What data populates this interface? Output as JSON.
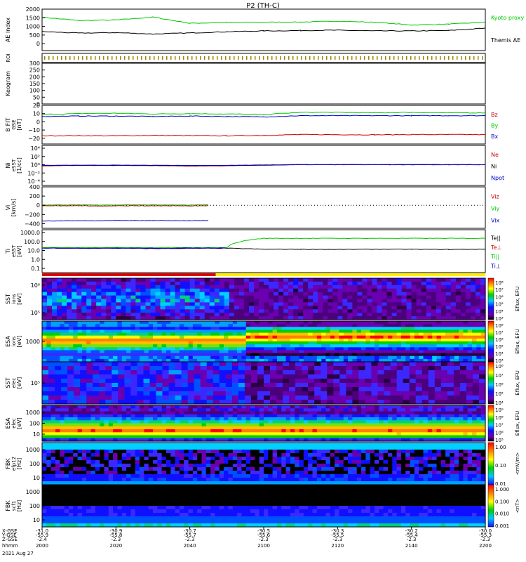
{
  "title": "P2 (TH-C)",
  "time_axis": {
    "row_labels": [
      "X-GSE",
      "Y-GSE",
      "Z-GSE",
      "hhmm",
      "2021 Aug 27"
    ],
    "columns": [
      {
        "x_gse": "-31.0",
        "y_gse": "-55.9",
        "z_gse": "-2.4",
        "hhmm": "2000"
      },
      {
        "x_gse": "-30.9",
        "y_gse": "-55.8",
        "z_gse": "-2.3",
        "hhmm": "2020"
      },
      {
        "x_gse": "-30.7",
        "y_gse": "-55.7",
        "z_gse": "-2.3",
        "hhmm": "2040"
      },
      {
        "x_gse": "-30.5",
        "y_gse": "-55.6",
        "z_gse": "-2.3",
        "hhmm": "2100"
      },
      {
        "x_gse": "-30.3",
        "y_gse": "-55.5",
        "z_gse": "-2.3",
        "hhmm": "2120"
      },
      {
        "x_gse": "-30.2",
        "y_gse": "-55.4",
        "z_gse": "-2.3",
        "hhmm": "2140"
      },
      {
        "x_gse": "-30.0",
        "y_gse": "-55.3",
        "z_gse": "-2.3",
        "hhmm": "2200"
      }
    ]
  },
  "colors": {
    "green": "#00c800",
    "red": "#c80000",
    "blue": "#0000c8",
    "black": "#000000",
    "mode_fast": "#e00000",
    "mode_slow": "#ffee00"
  },
  "chart_data": [
    {
      "panel": "ae",
      "type": "line",
      "ylabel": "AE Index",
      "ylim": [
        -400,
        2000
      ],
      "yticks": [
        "2000",
        "1500",
        "1000",
        "500",
        "0"
      ],
      "x": [
        "2000",
        "2010",
        "2020",
        "2030",
        "2040",
        "2050",
        "2100",
        "2110",
        "2120",
        "2130",
        "2140",
        "2150",
        "2200"
      ],
      "series": [
        {
          "name": "Kyoto proxy AE",
          "color": "green",
          "values": [
            1530,
            1340,
            1370,
            1540,
            1180,
            1230,
            1240,
            1250,
            1300,
            1240,
            1080,
            1130,
            1250
          ]
        },
        {
          "name": "Themis AE",
          "color": "black",
          "values": [
            700,
            610,
            640,
            560,
            620,
            690,
            740,
            760,
            780,
            740,
            740,
            760,
            900
          ]
        }
      ]
    },
    {
      "panel": "roi",
      "type": "line",
      "ylabel": "ROI"
    },
    {
      "panel": "keogram",
      "type": "heatmap",
      "ylabel": "Keogram",
      "ylim": [
        0,
        300
      ],
      "yticks": [
        "300",
        "250",
        "200",
        "150",
        "100",
        "50",
        "0"
      ]
    },
    {
      "panel": "bfgm",
      "type": "line",
      "ylabel": "B FIT",
      "ylabel2": "GSE",
      "yunit": "[nT]",
      "ylim": [
        -27,
        20
      ],
      "yticks": [
        "20",
        "10",
        "0",
        "−10",
        "−20"
      ],
      "x": [
        "2000",
        "2010",
        "2020",
        "2030",
        "2040",
        "2050",
        "2100",
        "2110",
        "2120",
        "2130",
        "2140",
        "2150",
        "2200"
      ],
      "series": [
        {
          "name": "Bz",
          "color": "red",
          "values": [
            -17,
            -16.8,
            -17,
            -16.5,
            -16.8,
            -17,
            -16.5,
            -15.5,
            -15.6,
            -15.8,
            -15.5,
            -15.5,
            -15.6
          ]
        },
        {
          "name": "By",
          "color": "green",
          "values": [
            9,
            10,
            10.5,
            9.5,
            10,
            9.5,
            9,
            11.5,
            11.5,
            11,
            11.5,
            11,
            11
          ]
        },
        {
          "name": "Bx",
          "color": "blue",
          "values": [
            6.5,
            7,
            7,
            6.5,
            7,
            6.5,
            6,
            7.5,
            7.5,
            7.5,
            7.5,
            7.5,
            7.5
          ]
        }
      ]
    },
    {
      "panel": "density",
      "type": "line",
      "ylabel": "Ni",
      "ylabel2": "eSST",
      "yunit": "[1/cc]",
      "log_scale": true,
      "ylim": [
        1e-05,
        100000
      ],
      "yticks": [
        "10⁴",
        "10²",
        "10⁰",
        "10⁻²",
        "10⁻⁴"
      ],
      "x": [
        "2000",
        "2010",
        "2020",
        "2030",
        "2040",
        "2050",
        "2100",
        "2110",
        "2120",
        "2130",
        "2140",
        "2150",
        "2200"
      ],
      "series": [
        {
          "name": "Ne",
          "color": "red",
          "values": [
            0.8,
            1.0,
            1.0,
            0.9,
            0.7,
            0.8,
            1.2,
            1.6,
            1.6,
            1.5,
            1.6,
            1.5,
            1.5
          ]
        },
        {
          "name": "Ni",
          "color": "black",
          "values": [
            1.0,
            1.1,
            1.2,
            1.0,
            0.9,
            1.0,
            1.3,
            1.6,
            1.6,
            1.6,
            1.6,
            1.6,
            1.6
          ]
        },
        {
          "name": "Npot",
          "color": "blue",
          "values": [
            1.0,
            1.1,
            1.0,
            1.1,
            1.0,
            1.0,
            1.1,
            1.5,
            1.5,
            1.5,
            1.5,
            1.5,
            1.5
          ]
        }
      ]
    },
    {
      "panel": "velocity",
      "type": "line",
      "ylabel": "Vi",
      "yunit": "[km/s]",
      "ylim": [
        -500,
        400
      ],
      "yticks": [
        "400",
        "200",
        "0",
        "−200",
        "−400"
      ],
      "x": [
        "2000",
        "2005",
        "2010",
        "2015",
        "2020",
        "2025",
        "2030",
        "2035",
        "2040",
        "2045"
      ],
      "series": [
        {
          "name": "Viz",
          "color": "red",
          "values": [
            -10,
            -12,
            -10,
            -15,
            -12,
            -10,
            -12,
            -10,
            -12,
            -10
          ]
        },
        {
          "name": "Viy",
          "color": "green",
          "values": [
            5,
            8,
            10,
            6,
            8,
            12,
            10,
            8,
            6,
            10
          ]
        },
        {
          "name": "Vix",
          "color": "blue",
          "values": [
            -340,
            -338,
            -335,
            -336,
            -330,
            -332,
            -330,
            -334,
            -336,
            -330
          ]
        }
      ]
    },
    {
      "panel": "temperature",
      "type": "line",
      "ylabel": "Ti",
      "ylabel2": "eSST",
      "yunit": "[eV]",
      "log_scale": true,
      "ylim": [
        0.05,
        3000
      ],
      "yticks": [
        "1000.0",
        "100.0",
        "10.0",
        "1.0",
        "0.1"
      ],
      "x": [
        "2000",
        "2010",
        "2020",
        "2030",
        "2040",
        "2050",
        "2100",
        "2110",
        "2120",
        "2130",
        "2140",
        "2150",
        "2200"
      ],
      "series": [
        {
          "name": "Te||",
          "color": "black",
          "values": [
            27,
            25,
            26,
            24,
            25,
            26,
            20,
            20,
            19,
            20,
            20,
            19,
            20
          ]
        },
        {
          "name": "Te⊥",
          "color": "red",
          "values": [
            30,
            28,
            30,
            27,
            28,
            29,
            null,
            null,
            null,
            null,
            null,
            null,
            null
          ]
        },
        {
          "name": "Ti||",
          "color": "green",
          "values": [
            32,
            30,
            31,
            29,
            30,
            30,
            330,
            330,
            330,
            330,
            330,
            330,
            330
          ]
        },
        {
          "name": "Ti⊥",
          "color": "blue",
          "values": [
            28,
            26,
            27,
            26,
            27,
            28,
            null,
            null,
            null,
            null,
            null,
            null,
            null
          ]
        }
      ]
    },
    {
      "panel": "sst_ion",
      "type": "heatmap",
      "ylabel": "SST",
      "ylabel2": "ions",
      "yunit": "[eV]",
      "yticks": [
        "10⁶",
        "10⁵"
      ],
      "colorbar": {
        "label": "Eflux, EFU",
        "ticks": [
          "10⁸",
          "10⁷",
          "10⁶",
          "10⁵",
          "10⁴",
          "10³"
        ]
      }
    },
    {
      "panel": "esa_ion",
      "type": "heatmap",
      "ylabel": "ESA",
      "ylabel2": "ions",
      "yunit": "[eV]",
      "yticks": [
        "1000"
      ],
      "colorbar": {
        "label": "Eflux, EFU",
        "ticks": [
          "10⁸",
          "10⁷",
          "10⁶",
          "10⁵",
          "10⁴",
          "10³"
        ]
      }
    },
    {
      "panel": "sst_elec",
      "type": "heatmap",
      "ylabel": "SST",
      "ylabel2": "elec",
      "yunit": "[eV]",
      "yticks": [
        "10⁵"
      ],
      "colorbar": {
        "label": "Eflux, EFU",
        "ticks": [
          "10⁸",
          "10⁷",
          "10⁶",
          "10⁵",
          "10⁴"
        ]
      }
    },
    {
      "panel": "esa_elec",
      "type": "heatmap",
      "ylabel": "ESA",
      "ylabel2": "elec",
      "yunit": "[eV]",
      "yticks": [
        "1000",
        "100",
        "10"
      ],
      "colorbar": {
        "label": "Eflux, EFU",
        "ticks": [
          "10⁹",
          "10⁸",
          "10⁷",
          "10⁶",
          "10⁵"
        ]
      }
    },
    {
      "panel": "fbk_e",
      "type": "heatmap",
      "ylabel": "FBK",
      "ylabel2": "efp12",
      "yunit": "[Hz]",
      "yticks": [
        "1000",
        "100",
        "10"
      ],
      "colorbar": {
        "label": "<mV/m>",
        "ticks": [
          "1.00",
          "0.10",
          "0.01"
        ]
      }
    },
    {
      "panel": "fbk_b",
      "type": "heatmap",
      "ylabel": "FBK",
      "ylabel2": "scf1",
      "yunit": "[Hz]",
      "yticks": [
        "1000",
        "100",
        "10"
      ],
      "colorbar": {
        "label": "<nT>",
        "ticks": [
          "1.000",
          "0.100",
          "0.010",
          "0.001"
        ]
      }
    }
  ]
}
